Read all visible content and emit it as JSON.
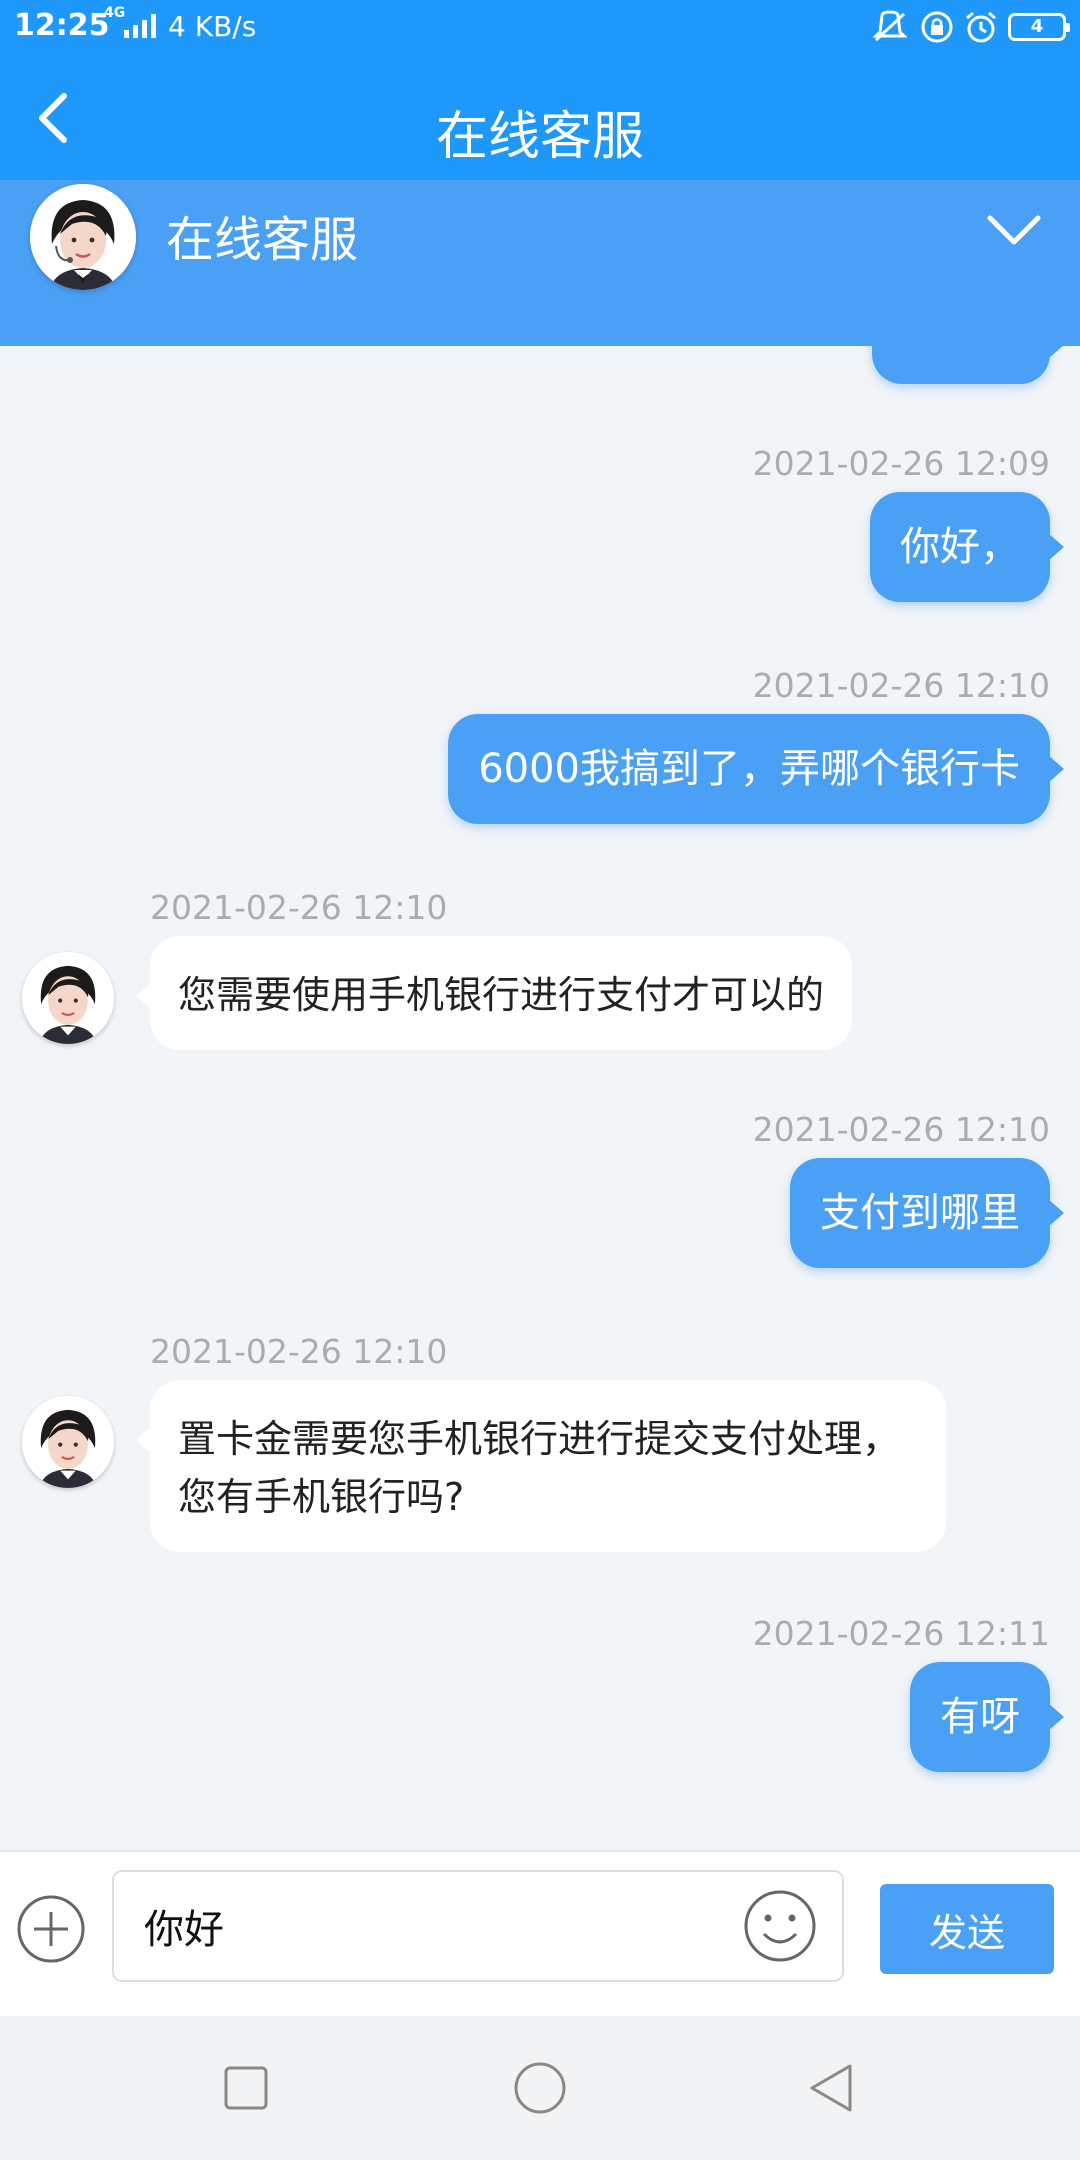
{
  "status_bar": {
    "time": "12:25",
    "network": "4G",
    "speed": "4 KB/s",
    "battery": "4",
    "icons": [
      "mute-icon",
      "lock-rotation-icon",
      "alarm-icon",
      "battery-icon"
    ]
  },
  "title_bar": {
    "title": "在线客服",
    "back_icon": "chevron-left-icon"
  },
  "agent": {
    "name": "在线客服",
    "collapse_icon": "chevron-down-icon"
  },
  "messages": [
    {
      "direction": "out",
      "time": "2021-02-26 12:09",
      "text": "你好，"
    },
    {
      "direction": "out",
      "time": "2021-02-26 12:10",
      "text": "6000我搞到了，弄哪个银行卡"
    },
    {
      "direction": "in",
      "time": "2021-02-26 12:10",
      "text": "您需要使用手机银行进行支付才可以的"
    },
    {
      "direction": "out",
      "time": "2021-02-26 12:10",
      "text": "支付到哪里"
    },
    {
      "direction": "in",
      "time": "2021-02-26 12:10",
      "text": "置卡金需要您手机银行进行提交支付处理，您有手机银行吗?"
    },
    {
      "direction": "out",
      "time": "2021-02-26 12:11",
      "text": "有呀"
    }
  ],
  "input_bar": {
    "value": "你好",
    "send_label": "发送",
    "plus_icon": "plus-circle-icon",
    "emoji_icon": "smiley-icon"
  },
  "nav_bar": {
    "icons": [
      "square-icon",
      "circle-icon",
      "triangle-back-icon"
    ]
  },
  "colors": {
    "primary": "#1e98fb",
    "bubble_out": "#4aa0f5",
    "background": "#f2f5f8"
  }
}
